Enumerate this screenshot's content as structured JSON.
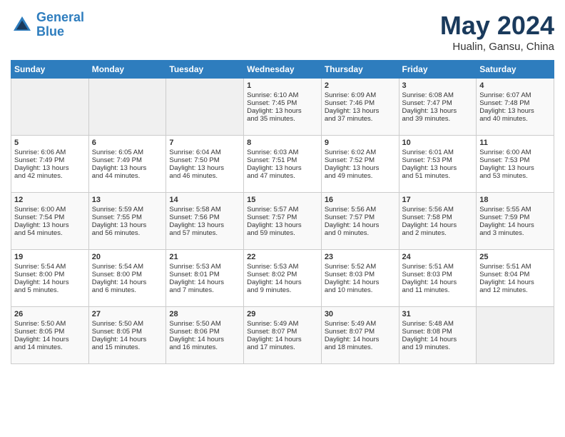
{
  "header": {
    "logo_line1": "General",
    "logo_line2": "Blue",
    "month": "May 2024",
    "location": "Hualin, Gansu, China"
  },
  "days_of_week": [
    "Sunday",
    "Monday",
    "Tuesday",
    "Wednesday",
    "Thursday",
    "Friday",
    "Saturday"
  ],
  "weeks": [
    [
      {
        "day": "",
        "content": ""
      },
      {
        "day": "",
        "content": ""
      },
      {
        "day": "",
        "content": ""
      },
      {
        "day": "1",
        "content": "Sunrise: 6:10 AM\nSunset: 7:45 PM\nDaylight: 13 hours\nand 35 minutes."
      },
      {
        "day": "2",
        "content": "Sunrise: 6:09 AM\nSunset: 7:46 PM\nDaylight: 13 hours\nand 37 minutes."
      },
      {
        "day": "3",
        "content": "Sunrise: 6:08 AM\nSunset: 7:47 PM\nDaylight: 13 hours\nand 39 minutes."
      },
      {
        "day": "4",
        "content": "Sunrise: 6:07 AM\nSunset: 7:48 PM\nDaylight: 13 hours\nand 40 minutes."
      }
    ],
    [
      {
        "day": "5",
        "content": "Sunrise: 6:06 AM\nSunset: 7:49 PM\nDaylight: 13 hours\nand 42 minutes."
      },
      {
        "day": "6",
        "content": "Sunrise: 6:05 AM\nSunset: 7:49 PM\nDaylight: 13 hours\nand 44 minutes."
      },
      {
        "day": "7",
        "content": "Sunrise: 6:04 AM\nSunset: 7:50 PM\nDaylight: 13 hours\nand 46 minutes."
      },
      {
        "day": "8",
        "content": "Sunrise: 6:03 AM\nSunset: 7:51 PM\nDaylight: 13 hours\nand 47 minutes."
      },
      {
        "day": "9",
        "content": "Sunrise: 6:02 AM\nSunset: 7:52 PM\nDaylight: 13 hours\nand 49 minutes."
      },
      {
        "day": "10",
        "content": "Sunrise: 6:01 AM\nSunset: 7:53 PM\nDaylight: 13 hours\nand 51 minutes."
      },
      {
        "day": "11",
        "content": "Sunrise: 6:00 AM\nSunset: 7:53 PM\nDaylight: 13 hours\nand 53 minutes."
      }
    ],
    [
      {
        "day": "12",
        "content": "Sunrise: 6:00 AM\nSunset: 7:54 PM\nDaylight: 13 hours\nand 54 minutes."
      },
      {
        "day": "13",
        "content": "Sunrise: 5:59 AM\nSunset: 7:55 PM\nDaylight: 13 hours\nand 56 minutes."
      },
      {
        "day": "14",
        "content": "Sunrise: 5:58 AM\nSunset: 7:56 PM\nDaylight: 13 hours\nand 57 minutes."
      },
      {
        "day": "15",
        "content": "Sunrise: 5:57 AM\nSunset: 7:57 PM\nDaylight: 13 hours\nand 59 minutes."
      },
      {
        "day": "16",
        "content": "Sunrise: 5:56 AM\nSunset: 7:57 PM\nDaylight: 14 hours\nand 0 minutes."
      },
      {
        "day": "17",
        "content": "Sunrise: 5:56 AM\nSunset: 7:58 PM\nDaylight: 14 hours\nand 2 minutes."
      },
      {
        "day": "18",
        "content": "Sunrise: 5:55 AM\nSunset: 7:59 PM\nDaylight: 14 hours\nand 3 minutes."
      }
    ],
    [
      {
        "day": "19",
        "content": "Sunrise: 5:54 AM\nSunset: 8:00 PM\nDaylight: 14 hours\nand 5 minutes."
      },
      {
        "day": "20",
        "content": "Sunrise: 5:54 AM\nSunset: 8:00 PM\nDaylight: 14 hours\nand 6 minutes."
      },
      {
        "day": "21",
        "content": "Sunrise: 5:53 AM\nSunset: 8:01 PM\nDaylight: 14 hours\nand 7 minutes."
      },
      {
        "day": "22",
        "content": "Sunrise: 5:53 AM\nSunset: 8:02 PM\nDaylight: 14 hours\nand 9 minutes."
      },
      {
        "day": "23",
        "content": "Sunrise: 5:52 AM\nSunset: 8:03 PM\nDaylight: 14 hours\nand 10 minutes."
      },
      {
        "day": "24",
        "content": "Sunrise: 5:51 AM\nSunset: 8:03 PM\nDaylight: 14 hours\nand 11 minutes."
      },
      {
        "day": "25",
        "content": "Sunrise: 5:51 AM\nSunset: 8:04 PM\nDaylight: 14 hours\nand 12 minutes."
      }
    ],
    [
      {
        "day": "26",
        "content": "Sunrise: 5:50 AM\nSunset: 8:05 PM\nDaylight: 14 hours\nand 14 minutes."
      },
      {
        "day": "27",
        "content": "Sunrise: 5:50 AM\nSunset: 8:05 PM\nDaylight: 14 hours\nand 15 minutes."
      },
      {
        "day": "28",
        "content": "Sunrise: 5:50 AM\nSunset: 8:06 PM\nDaylight: 14 hours\nand 16 minutes."
      },
      {
        "day": "29",
        "content": "Sunrise: 5:49 AM\nSunset: 8:07 PM\nDaylight: 14 hours\nand 17 minutes."
      },
      {
        "day": "30",
        "content": "Sunrise: 5:49 AM\nSunset: 8:07 PM\nDaylight: 14 hours\nand 18 minutes."
      },
      {
        "day": "31",
        "content": "Sunrise: 5:48 AM\nSunset: 8:08 PM\nDaylight: 14 hours\nand 19 minutes."
      },
      {
        "day": "",
        "content": ""
      }
    ]
  ]
}
